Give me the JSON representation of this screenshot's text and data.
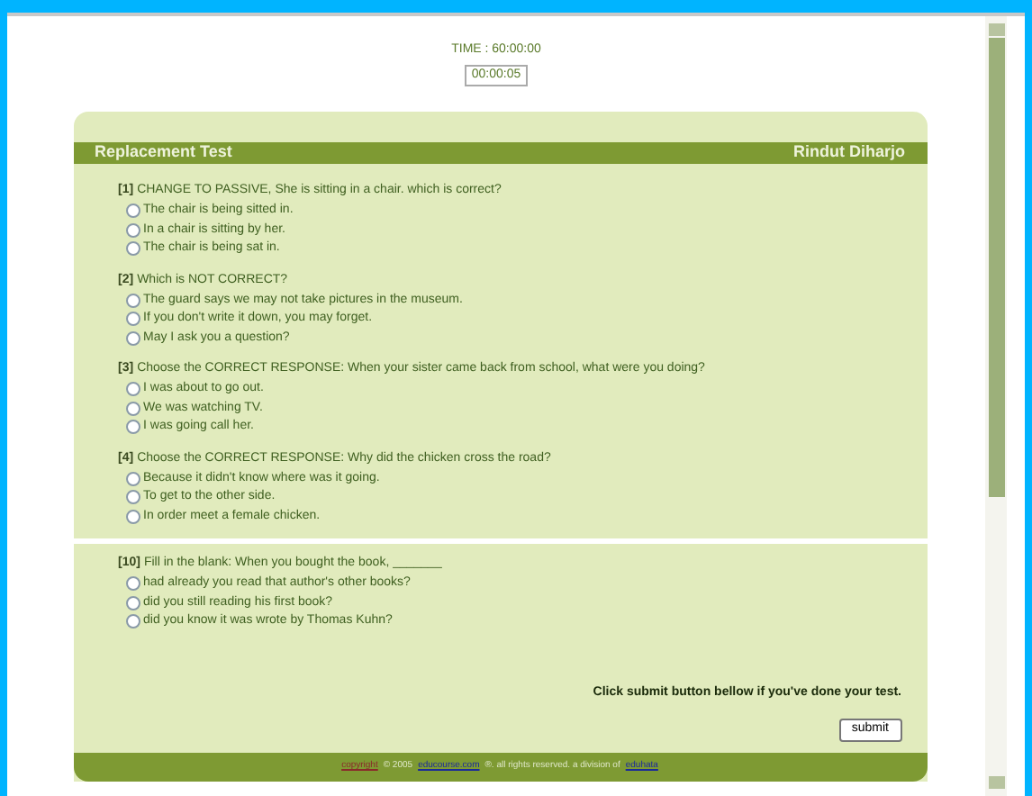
{
  "timer": {
    "label": "TIME : 60:00:00",
    "value": "00:00:05"
  },
  "header": {
    "title": "Replacement Test",
    "user": "Rindut Diharjo"
  },
  "sections": [
    {
      "questions": [
        {
          "number": "[1]",
          "text": "CHANGE TO PASSIVE, She is sitting in a chair. which is correct?",
          "options": [
            {
              "label": "The chair is being sitted in.",
              "selected": false
            },
            {
              "label": "In a chair is sitting by her.",
              "selected": false
            },
            {
              "label": "The chair is being sat in.",
              "selected": false
            }
          ]
        },
        {
          "number": "[2]",
          "text": "Which is NOT CORRECT?",
          "options": [
            {
              "label": "The guard says we may not take pictures in the museum.",
              "selected": false
            },
            {
              "label": "If you don't write it down, you may forget.",
              "selected": false
            },
            {
              "label": "May I ask you a question?",
              "selected": false
            }
          ]
        },
        {
          "number": "[3]",
          "text": "Choose the CORRECT RESPONSE: When your sister came back from school, what were you doing?",
          "options": [
            {
              "label": "I was about to go out.",
              "selected": false
            },
            {
              "label": "We was watching TV.",
              "selected": false
            },
            {
              "label": "I was going call her.",
              "selected": false
            }
          ]
        },
        {
          "number": "[4]",
          "text": "Choose the CORRECT RESPONSE: Why did the chicken cross the road?",
          "options": [
            {
              "label": "Because it didn't know where was it going.",
              "selected": false
            },
            {
              "label": "To get to the other side.",
              "selected": false
            },
            {
              "label": "In order meet a female chicken.",
              "selected": false
            }
          ]
        }
      ]
    },
    {
      "questions": [
        {
          "number": "[10]",
          "text": "Fill in the blank: When you bought the book, _______",
          "options": [
            {
              "label": "had already you read that author's other books?",
              "selected": false
            },
            {
              "label": "did you still reading his first book?",
              "selected": false
            },
            {
              "label": "did you know it was wrote by Thomas Kuhn?",
              "selected": false
            }
          ]
        }
      ]
    }
  ],
  "instruction": "Click submit button bellow if you've done your test.",
  "submit_button": "submit",
  "footer": [
    {
      "kind": "brand",
      "text": "copyright"
    },
    {
      "kind": "text",
      "text": "© 2005"
    },
    {
      "kind": "link",
      "text": "educourse.com"
    },
    {
      "kind": "text",
      "text": "®. all rights reserved. a division of"
    },
    {
      "kind": "link",
      "text": "eduhata"
    }
  ]
}
